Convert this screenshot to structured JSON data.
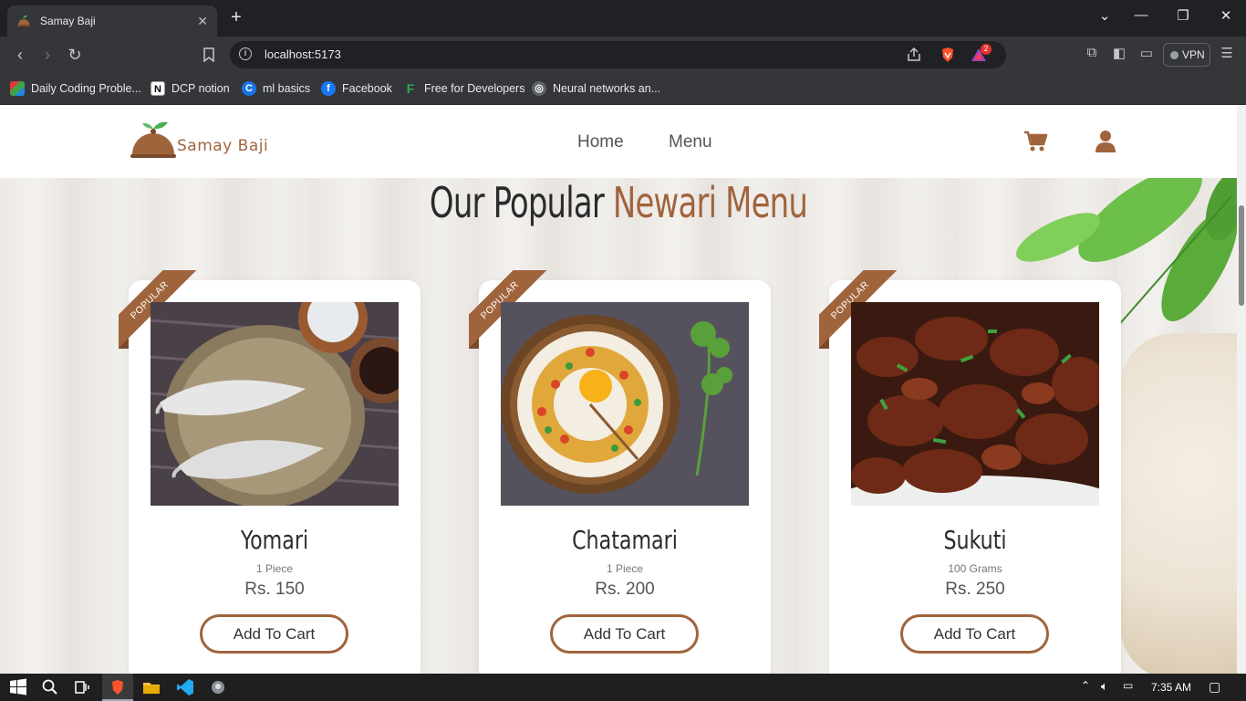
{
  "browser": {
    "tab_title": "Samay Baji",
    "url": "localhost:5173",
    "vpn_label": "VPN",
    "brave_badge": "2",
    "bookmarks": [
      {
        "label": "Daily Coding Proble...",
        "icon": "mosaic-icon"
      },
      {
        "label": "DCP notion",
        "icon": "notion-icon"
      },
      {
        "label": "ml basics",
        "icon": "c-icon"
      },
      {
        "label": "Facebook",
        "icon": "facebook-icon"
      },
      {
        "label": "Free for Developers",
        "icon": "f-icon"
      },
      {
        "label": "Neural networks an...",
        "icon": "globe-icon"
      }
    ]
  },
  "site": {
    "logo_text": "Samay Baji",
    "nav": {
      "home": "Home",
      "menu": "Menu"
    },
    "title_main": "Our Popular",
    "title_accent": "Newari Menu",
    "accent_color": "#a0643c"
  },
  "cards": [
    {
      "ribbon": "POPULAR",
      "name": "Yomari",
      "qty": "1 Piece",
      "price": "Rs. 150",
      "button": "Add To Cart"
    },
    {
      "ribbon": "POPULAR",
      "name": "Chatamari",
      "qty": "1 Piece",
      "price": "Rs. 200",
      "button": "Add To Cart"
    },
    {
      "ribbon": "POPULAR",
      "name": "Sukuti",
      "qty": "100 Grams",
      "price": "Rs. 250",
      "button": "Add To Cart"
    }
  ],
  "taskbar": {
    "time": "7:35 AM"
  }
}
